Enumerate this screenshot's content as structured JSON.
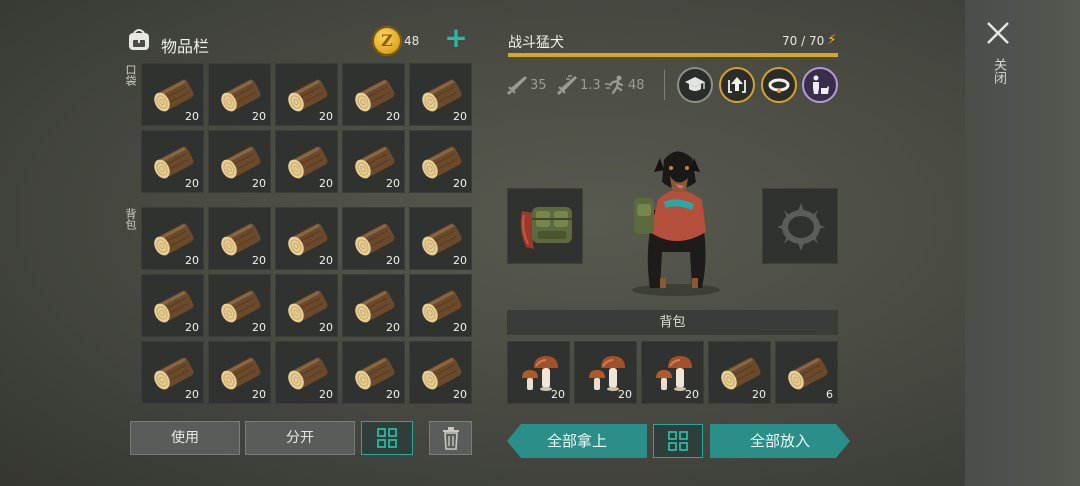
{
  "inventory": {
    "title": "物品栏",
    "coins": "48",
    "pockets_label": "口袋",
    "backpack_label": "背包",
    "pockets": [
      {
        "item": "log",
        "qty": "20"
      },
      {
        "item": "log",
        "qty": "20"
      },
      {
        "item": "log",
        "qty": "20"
      },
      {
        "item": "log",
        "qty": "20"
      },
      {
        "item": "log",
        "qty": "20"
      },
      {
        "item": "log",
        "qty": "20"
      },
      {
        "item": "log",
        "qty": "20"
      },
      {
        "item": "log",
        "qty": "20"
      },
      {
        "item": "log",
        "qty": "20"
      },
      {
        "item": "log",
        "qty": "20"
      }
    ],
    "backpack": [
      {
        "item": "log",
        "qty": "20"
      },
      {
        "item": "log",
        "qty": "20"
      },
      {
        "item": "log",
        "qty": "20"
      },
      {
        "item": "log",
        "qty": "20"
      },
      {
        "item": "log",
        "qty": "20"
      },
      {
        "item": "log",
        "qty": "20"
      },
      {
        "item": "log",
        "qty": "20"
      },
      {
        "item": "log",
        "qty": "20"
      },
      {
        "item": "log",
        "qty": "20"
      },
      {
        "item": "log",
        "qty": "20"
      },
      {
        "item": "log",
        "qty": "20"
      },
      {
        "item": "log",
        "qty": "20"
      },
      {
        "item": "log",
        "qty": "20"
      },
      {
        "item": "log",
        "qty": "20"
      },
      {
        "item": "log",
        "qty": "20"
      }
    ],
    "buttons": {
      "use": "使用",
      "split": "分开"
    }
  },
  "pet": {
    "name": "战斗猛犬",
    "hp": "70 / 70",
    "stats": {
      "attack": "35",
      "attack_speed": "1.3",
      "speed": "48"
    },
    "skills": [
      "graduation-cap-icon",
      "level-up-icon",
      "collar-icon",
      "owner-pet-icon"
    ],
    "pack_label": "背包",
    "pack": [
      {
        "item": "mushroom",
        "qty": "20"
      },
      {
        "item": "mushroom",
        "qty": "20"
      },
      {
        "item": "mushroom",
        "qty": "20"
      },
      {
        "item": "log",
        "qty": "20"
      },
      {
        "item": "log",
        "qty": "6"
      }
    ],
    "take_all": "全部拿上",
    "put_all": "全部放入"
  },
  "close_label": "关闭",
  "colors": {
    "accent": "#2a8f88",
    "hp_bar": "#d9a821",
    "plus": "#28b8a6"
  }
}
